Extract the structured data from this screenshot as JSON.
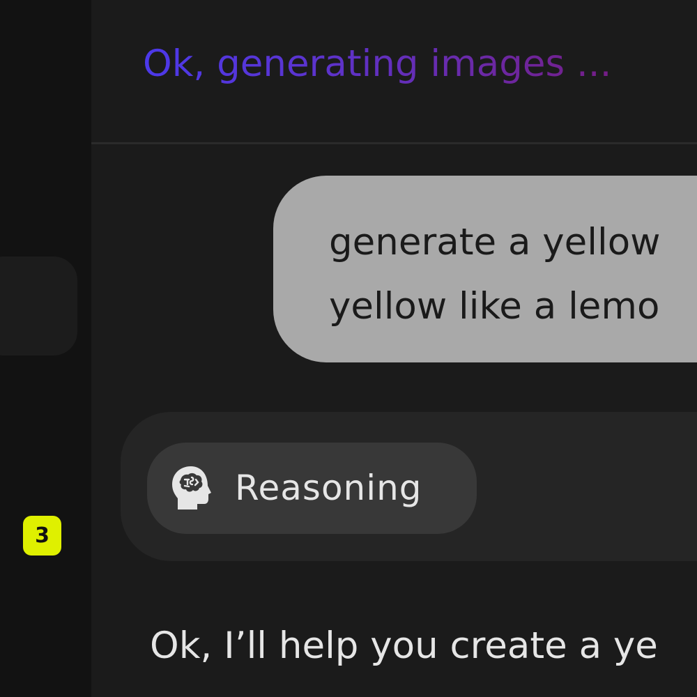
{
  "sidebar": {
    "badge_count": "3",
    "badge_color": "#dff000"
  },
  "header": {
    "status_text": "Ok, generating images ...",
    "status_gradient": [
      "#4c39ea",
      "#741d86"
    ]
  },
  "conversation": {
    "user_message": "generate a yellow\nyellow like a lemo",
    "reasoning": {
      "icon": "brain-head-icon",
      "label": "Reasoning"
    },
    "assistant_message": "Ok, I’ll help you create a ye"
  }
}
